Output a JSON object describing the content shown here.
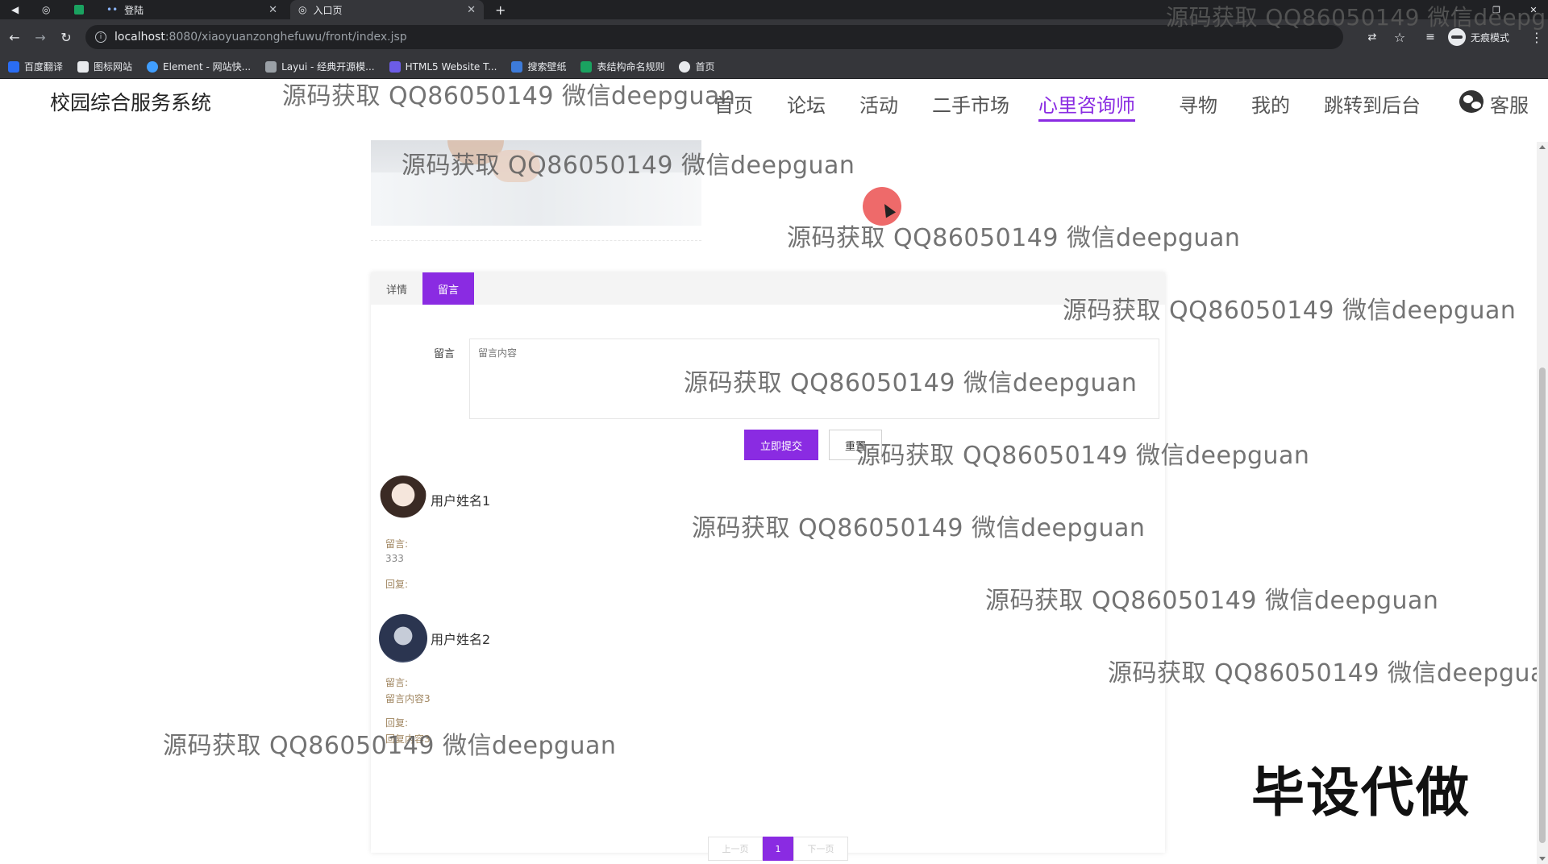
{
  "browser": {
    "tabs": [
      {
        "title": "登陆",
        "active": false
      },
      {
        "title": "入口页",
        "active": true
      }
    ],
    "new_tab_symbol": "+",
    "url_host": "localhost",
    "url_path": ":8080/xiaoyuanzonghefuwu/front/index.jsp",
    "incognito_label": "无痕模式",
    "bookmarks": [
      {
        "label": "百度翻译",
        "color": "#2a6df4"
      },
      {
        "label": "图标网站",
        "color": "#e8eaed"
      },
      {
        "label": "Element - 网站快...",
        "color": "#409eff"
      },
      {
        "label": "Layui - 经典开源模...",
        "color": "#e8eaed"
      },
      {
        "label": "HTML5 Website T...",
        "color": "#6c5ce7"
      },
      {
        "label": "搜索壁纸",
        "color": "#3d7bd9"
      },
      {
        "label": "表结构命名规则",
        "color": "#1aa260"
      },
      {
        "label": "首页",
        "color": "#e8eaed"
      }
    ]
  },
  "site": {
    "title": "校园综合服务系统",
    "nav": [
      {
        "label": "首页",
        "active": false
      },
      {
        "label": "论坛",
        "active": false
      },
      {
        "label": "活动",
        "active": false
      },
      {
        "label": "二手市场",
        "active": false
      },
      {
        "label": "心里咨询师",
        "active": true
      },
      {
        "label": "寻物",
        "active": false
      },
      {
        "label": "我的",
        "active": false
      },
      {
        "label": "跳转到后台",
        "active": false
      }
    ],
    "kefu_label": "客服",
    "accent_color": "#8a2be2"
  },
  "detail": {
    "tabs": {
      "detail": "详情",
      "message": "留言"
    },
    "form": {
      "label": "留言",
      "placeholder": "留言内容",
      "submit": "立即提交",
      "reset": "重置"
    },
    "comments": [
      {
        "name": "用户姓名1",
        "message_label": "留言:",
        "message": "333",
        "reply_label": "回复:",
        "reply": ""
      },
      {
        "name": "用户姓名2",
        "message_label": "留言:",
        "message": "留言内容3",
        "reply_label": "回复:",
        "reply": "回复内容3"
      }
    ],
    "pagination": {
      "prev": "上一页",
      "current": "1",
      "next": "下一页"
    }
  },
  "overlays": {
    "watermark_text": "源码获取 QQ86050149 微信deepguan",
    "promo_text": "毕设代做"
  }
}
